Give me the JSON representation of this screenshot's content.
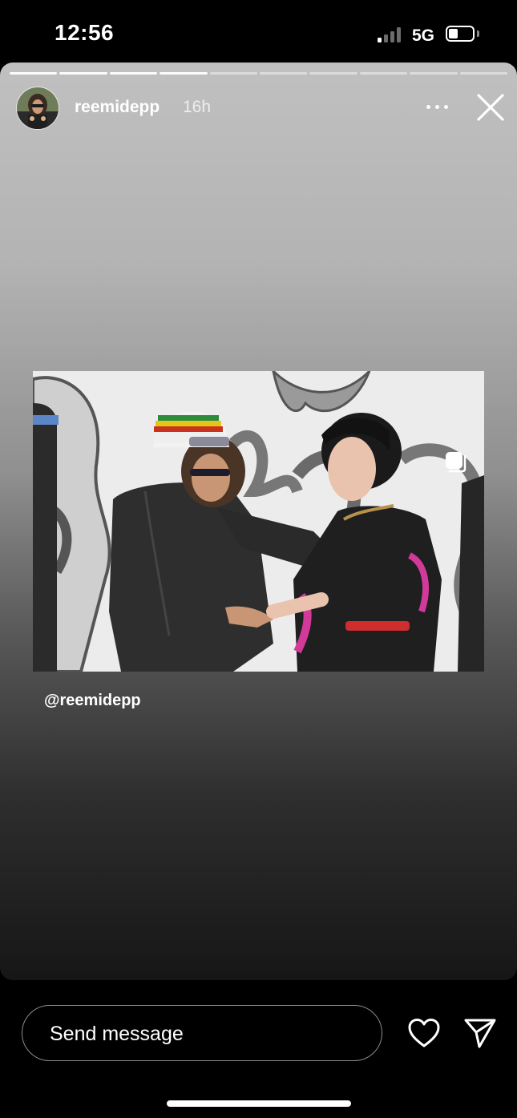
{
  "status_bar": {
    "time": "12:56",
    "network": "5G",
    "signal_bars_on": 1,
    "battery_level": 0.4
  },
  "story": {
    "segments_total": 10,
    "segments_done": 4,
    "username": "reemidepp",
    "posted_ago": "16h",
    "mention": "@reemidepp",
    "gradient_top": "#c0c0c0",
    "gradient_bottom": "#161616"
  },
  "reply": {
    "placeholder": "Send message"
  },
  "icons": {
    "more": "more-horizontal-icon",
    "close": "close-icon",
    "copy": "multiple-posts-icon",
    "like": "heart-icon",
    "share": "paper-plane-icon"
  }
}
